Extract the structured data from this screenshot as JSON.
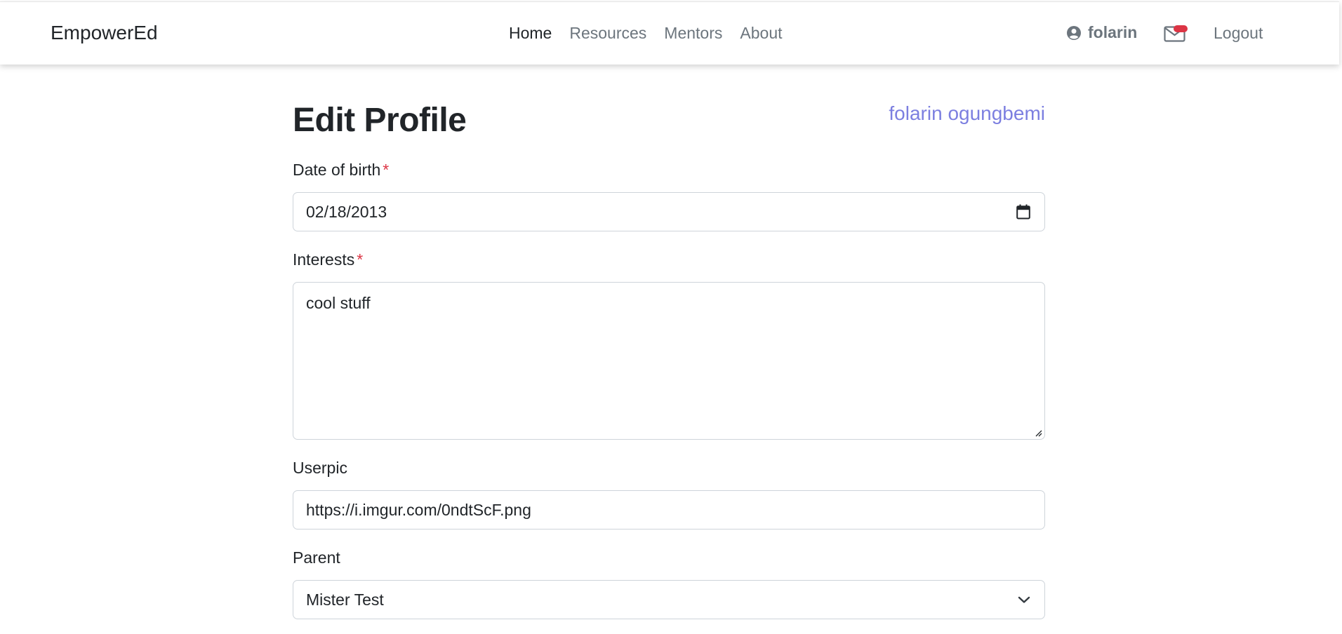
{
  "navbar": {
    "brand": "EmpowerEd",
    "links": [
      {
        "label": "Home",
        "active": true
      },
      {
        "label": "Resources",
        "active": false
      },
      {
        "label": "Mentors",
        "active": false
      },
      {
        "label": "About",
        "active": false
      }
    ],
    "username": "folarin",
    "user_icon": "user-circle-icon",
    "mail_icon": "envelope-icon",
    "notification_color": "#dc3545",
    "logout_label": "Logout"
  },
  "form": {
    "title": "Edit Profile",
    "full_name": "folarin ogungbemi",
    "required_marker": "*",
    "dob": {
      "label": "Date of birth",
      "value": "02/18/2013",
      "icon": "calendar-icon"
    },
    "interests": {
      "label": "Interests",
      "value": "cool stuff"
    },
    "userpic": {
      "label": "Userpic",
      "value": "https://i.imgur.com/0ndtScF.png"
    },
    "parent": {
      "label": "Parent",
      "value": "Mister Test",
      "icon": "chevron-down-icon"
    }
  },
  "colors": {
    "link_accent": "#7c7fe0",
    "required": "#dc3545",
    "muted_nav": "#6c757d"
  }
}
